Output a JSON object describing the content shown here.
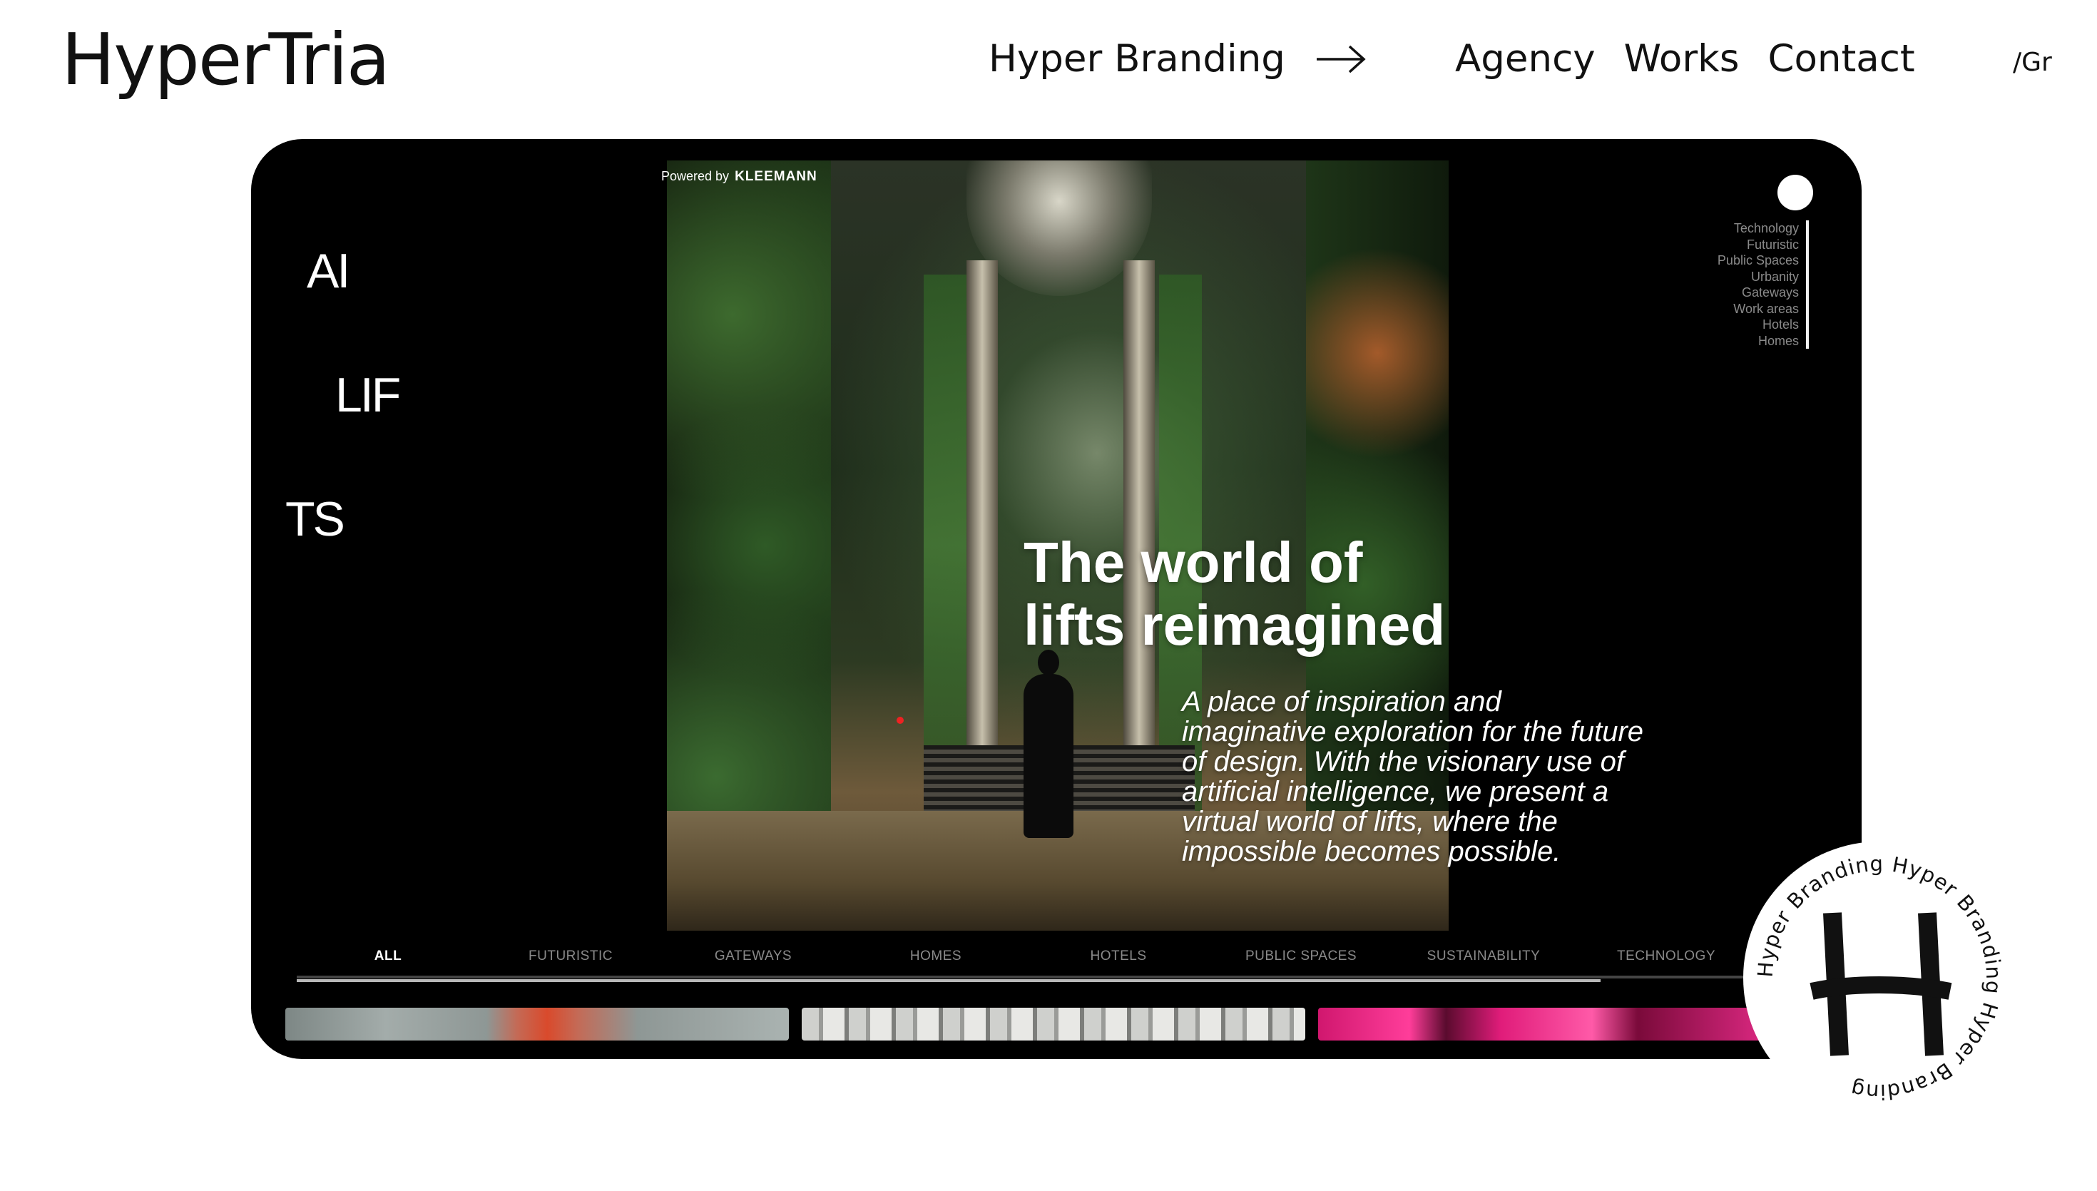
{
  "header": {
    "logo": "HyperTria",
    "cta_label": "Hyper Branding",
    "nav": [
      "Agency",
      "Works",
      "Contact"
    ],
    "language": "/Gr"
  },
  "device": {
    "site_logo_lines": [
      "AI",
      "LIF",
      "TS"
    ],
    "hero": {
      "powered_by_prefix": "Powered by",
      "powered_by_brand": "KLEEMANN",
      "title": "The world of\nlifts reimagined",
      "description": "A place of inspiration and imaginative exploration for the future of design. With the visionary use of artificial intelligence, we present a virtual world of lifts, where the impossible becomes possible."
    },
    "category_menu": [
      "Technology",
      "Futuristic",
      "Public Spaces",
      "Urbanity",
      "Gateways",
      "Work areas",
      "Hotels",
      "Homes"
    ],
    "filter_tabs": [
      "ALL",
      "FUTURISTIC",
      "GATEWAYS",
      "HOMES",
      "HOTELS",
      "PUBLIC SPACES",
      "SUSTAINABILITY",
      "TECHNOLOGY"
    ],
    "active_tab": "ALL"
  },
  "badge": {
    "ring_text": "Hyper Branding Hyper Branding Hyper Branding ",
    "monogram": "H"
  },
  "icons": {
    "cta_icon": "arrow-right-icon",
    "menu_icon": "circle-menu-icon"
  },
  "colors": {
    "page_background": "#ffffff",
    "frame_background": "#000000",
    "text_dark": "#111111",
    "text_light": "#ffffff",
    "muted_text": "#8a8a8a"
  }
}
